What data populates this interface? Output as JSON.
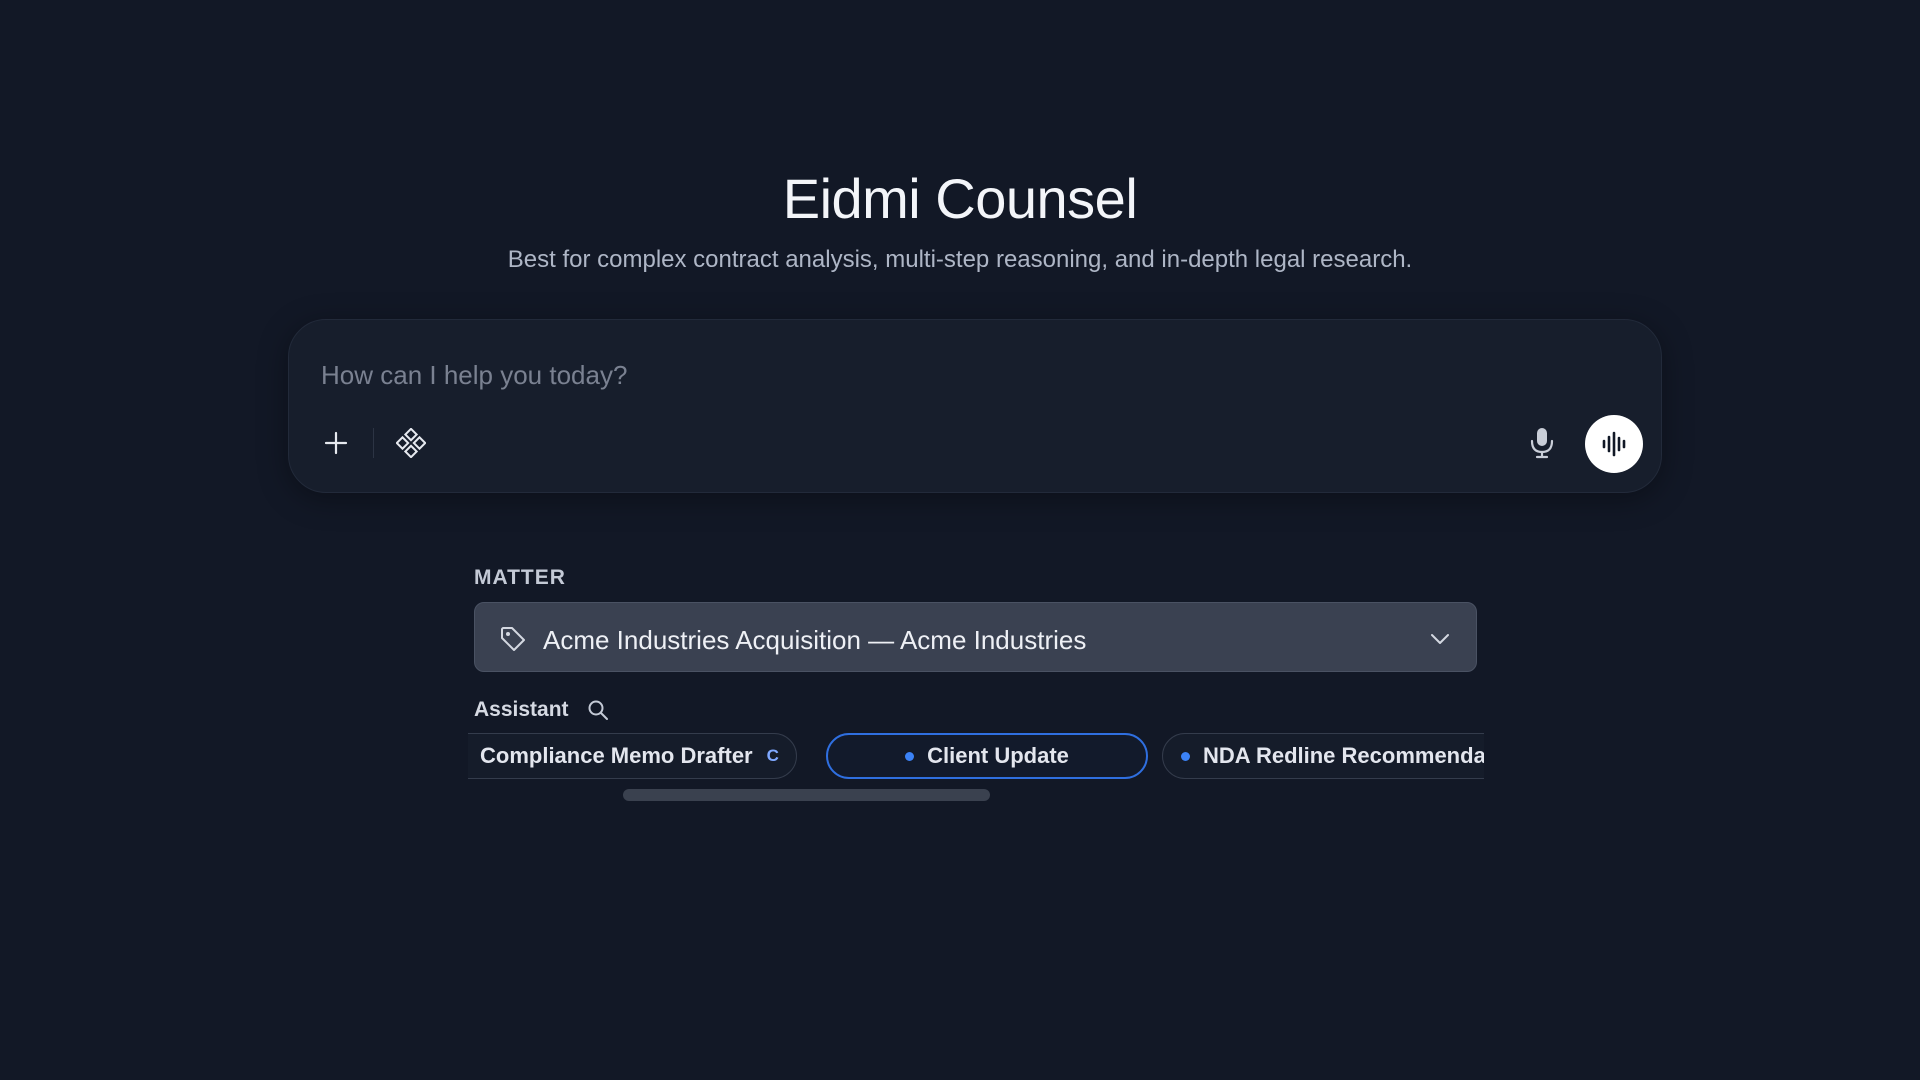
{
  "header": {
    "title": "Eidmi Counsel",
    "subtitle": "Best for complex contract analysis, multi-step reasoning, and in-depth legal research."
  },
  "composer": {
    "placeholder": "How can I help you today?",
    "value": "",
    "icons": [
      "plus-icon",
      "tools-icon",
      "microphone-icon",
      "voice-waveform-icon"
    ]
  },
  "matter": {
    "label": "MATTER",
    "selected": "Acme Industries Acquisition — Acme Industries",
    "icons": [
      "tag-icon",
      "chevron-down-icon"
    ]
  },
  "assistant": {
    "label": "Assistant",
    "chips": [
      {
        "label": "Compliance Memo Drafter",
        "badge": "C",
        "dot_color": "#c060f0",
        "selected": false
      },
      {
        "label": "Client Update",
        "dot_color": "#3b82f6",
        "selected": true
      },
      {
        "label": "NDA Redline Recommendations",
        "dot_color": "#3b82f6",
        "selected": false
      }
    ]
  },
  "colors": {
    "background": "#121826",
    "accent": "#2f6fe0",
    "purple_dot": "#c060f0",
    "blue_dot": "#3b82f6"
  }
}
